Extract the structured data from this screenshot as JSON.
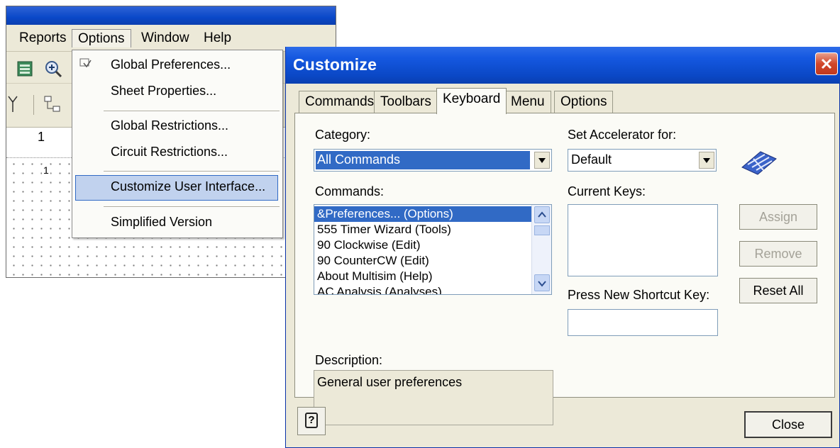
{
  "menubar": {
    "items": [
      {
        "label": "Reports"
      },
      {
        "label": "Options"
      },
      {
        "label": "Window"
      },
      {
        "label": "Help"
      }
    ]
  },
  "ruler": {
    "column": "1"
  },
  "workspace": {
    "marker": "1"
  },
  "options_menu": {
    "items": [
      {
        "label": "Global Preferences..."
      },
      {
        "label": "Sheet Properties..."
      },
      {
        "label": "Global Restrictions..."
      },
      {
        "label": "Circuit Restrictions..."
      },
      {
        "label": "Customize User Interface..."
      },
      {
        "label": "Simplified Version"
      }
    ]
  },
  "dialog": {
    "title": "Customize",
    "tabs": [
      {
        "label": "Commands"
      },
      {
        "label": "Toolbars"
      },
      {
        "label": "Keyboard"
      },
      {
        "label": "Menu"
      },
      {
        "label": "Options"
      }
    ],
    "category_label": "Category:",
    "category_value": "All Commands",
    "commands_label": "Commands:",
    "commands": [
      "&Preferences... (Options)",
      "555 Timer Wizard (Tools)",
      "90 Clockwise (Edit)",
      "90 CounterCW (Edit)",
      "About Multisim (Help)",
      "AC Analysis (Analyses)"
    ],
    "description_label": "Description:",
    "description_text": "General user preferences",
    "accelerator_label": "Set Accelerator for:",
    "accelerator_value": "Default",
    "current_keys_label": "Current Keys:",
    "new_shortcut_label": "Press New Shortcut Key:",
    "assign_label": "Assign",
    "remove_label": "Remove",
    "reset_all_label": "Reset All",
    "close_label": "Close",
    "help_glyph": "?"
  }
}
